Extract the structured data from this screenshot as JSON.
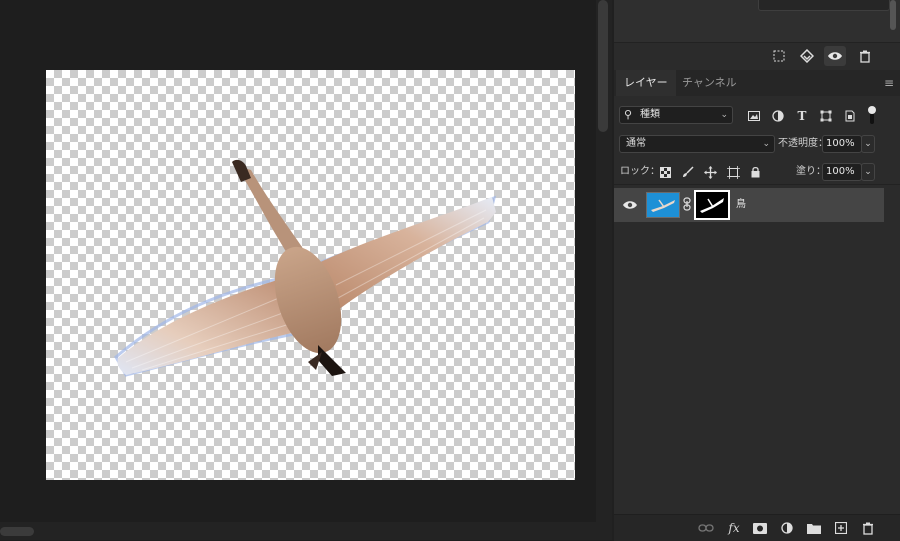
{
  "layers_panel": {
    "tabs": [
      {
        "label": "レイヤー",
        "active": true
      },
      {
        "label": "チャンネル",
        "active": false
      }
    ],
    "filter": {
      "label": "種類",
      "icon": "search-icon"
    },
    "blend_mode": "通常",
    "opacity_label": "不透明度：",
    "opacity_value": "100%",
    "lock_label": "ロック：",
    "fill_label": "塗り：",
    "fill_value": "100%",
    "layer": {
      "name": "鳥",
      "visible": true,
      "thumbnail_color": "#1e90d6"
    }
  },
  "properties_toolbar": {
    "icons": [
      "selection-icon",
      "mask-select-icon",
      "visibility-icon",
      "trash-icon"
    ]
  },
  "bottom_toolbar": {
    "fx_label": "fx",
    "icons": [
      "link-layers-icon",
      "fx-icon",
      "add-mask-icon",
      "adjustment-layer-icon",
      "group-folder-icon",
      "new-layer-icon",
      "delete-layer-icon"
    ]
  },
  "colors": {
    "canvas_bg": "#1e1e1e",
    "panel_bg": "#2b2b2b",
    "selected_layer": "#454545",
    "accent_blue": "#1e90d6"
  }
}
